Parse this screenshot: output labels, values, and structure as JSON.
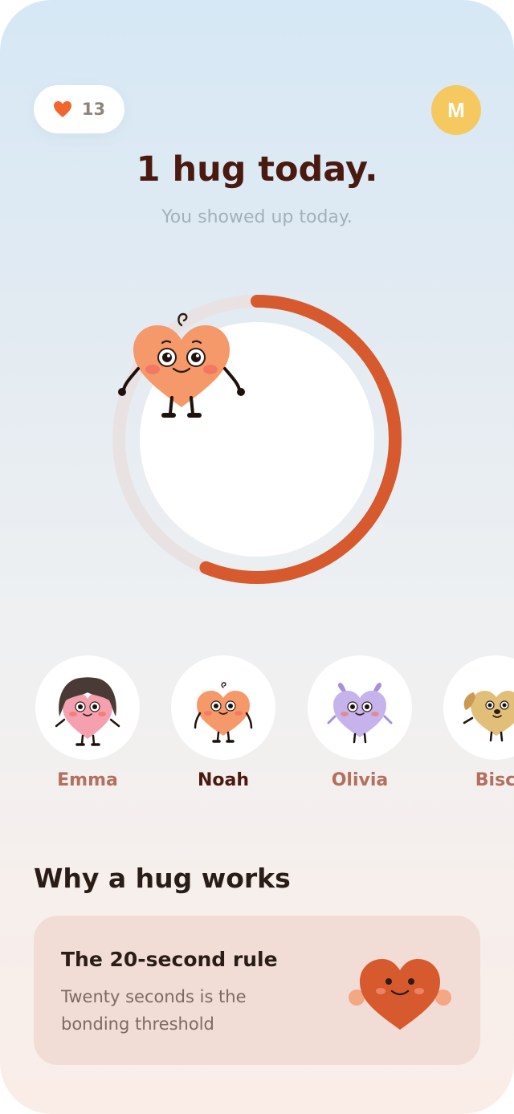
{
  "header": {
    "streak_count": "13",
    "avatar_initial": "M",
    "title": "1 hug today.",
    "subtitle": "You showed up today."
  },
  "progress": {
    "fraction": 0.56
  },
  "friends": [
    {
      "name": "Emma",
      "active": false
    },
    {
      "name": "Noah",
      "active": true
    },
    {
      "name": "Olivia",
      "active": false
    },
    {
      "name": "Bisc",
      "active": false
    }
  ],
  "section": {
    "title": "Why a hug works",
    "card": {
      "title": "The 20-second rule",
      "text": "Twenty seconds is the bonding threshold"
    }
  },
  "colors": {
    "accent": "#d65a2e",
    "heart": "#f5996a",
    "track": "#e8e2e3",
    "title": "#4a1a10"
  },
  "icons": [
    "heart-icon",
    "hug-heart-character",
    "thumbs-up-icon"
  ]
}
